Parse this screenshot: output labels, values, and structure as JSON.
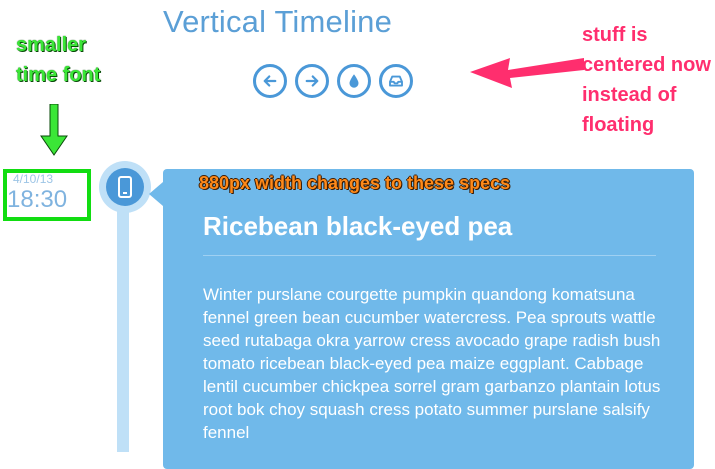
{
  "header": {
    "title": "Vertical Timeline",
    "nav_icons": [
      "arrow-left-icon",
      "arrow-right-icon",
      "droplet-icon",
      "inbox-icon"
    ]
  },
  "annotations": {
    "right_note": "stuff is centered now instead of floating",
    "left_note": "smaller time font",
    "card_note": "880px width changes to these specs",
    "colors": {
      "pink": "#ff2e6e",
      "green": "#3be637",
      "orange": "#ff8a1a"
    }
  },
  "timeline": {
    "date": "4/10/13",
    "time": "18:30",
    "icon": "mobile-icon",
    "card": {
      "title": "Ricebean black-eyed pea",
      "body": "Winter purslane courgette pumpkin quandong komatsuna fennel green bean cucumber watercress. Pea sprouts wattle seed rutabaga okra yarrow cress avocado grape radish bush tomato ricebean black-eyed pea maize eggplant. Cabbage lentil cucumber chickpea sorrel gram garbanzo plantain lotus root bok choy squash cress potato summer purslane salsify fennel"
    }
  },
  "theme": {
    "accent": "#4a98d8",
    "card_bg": "#70b9ea",
    "line": "#bfe0f7"
  }
}
